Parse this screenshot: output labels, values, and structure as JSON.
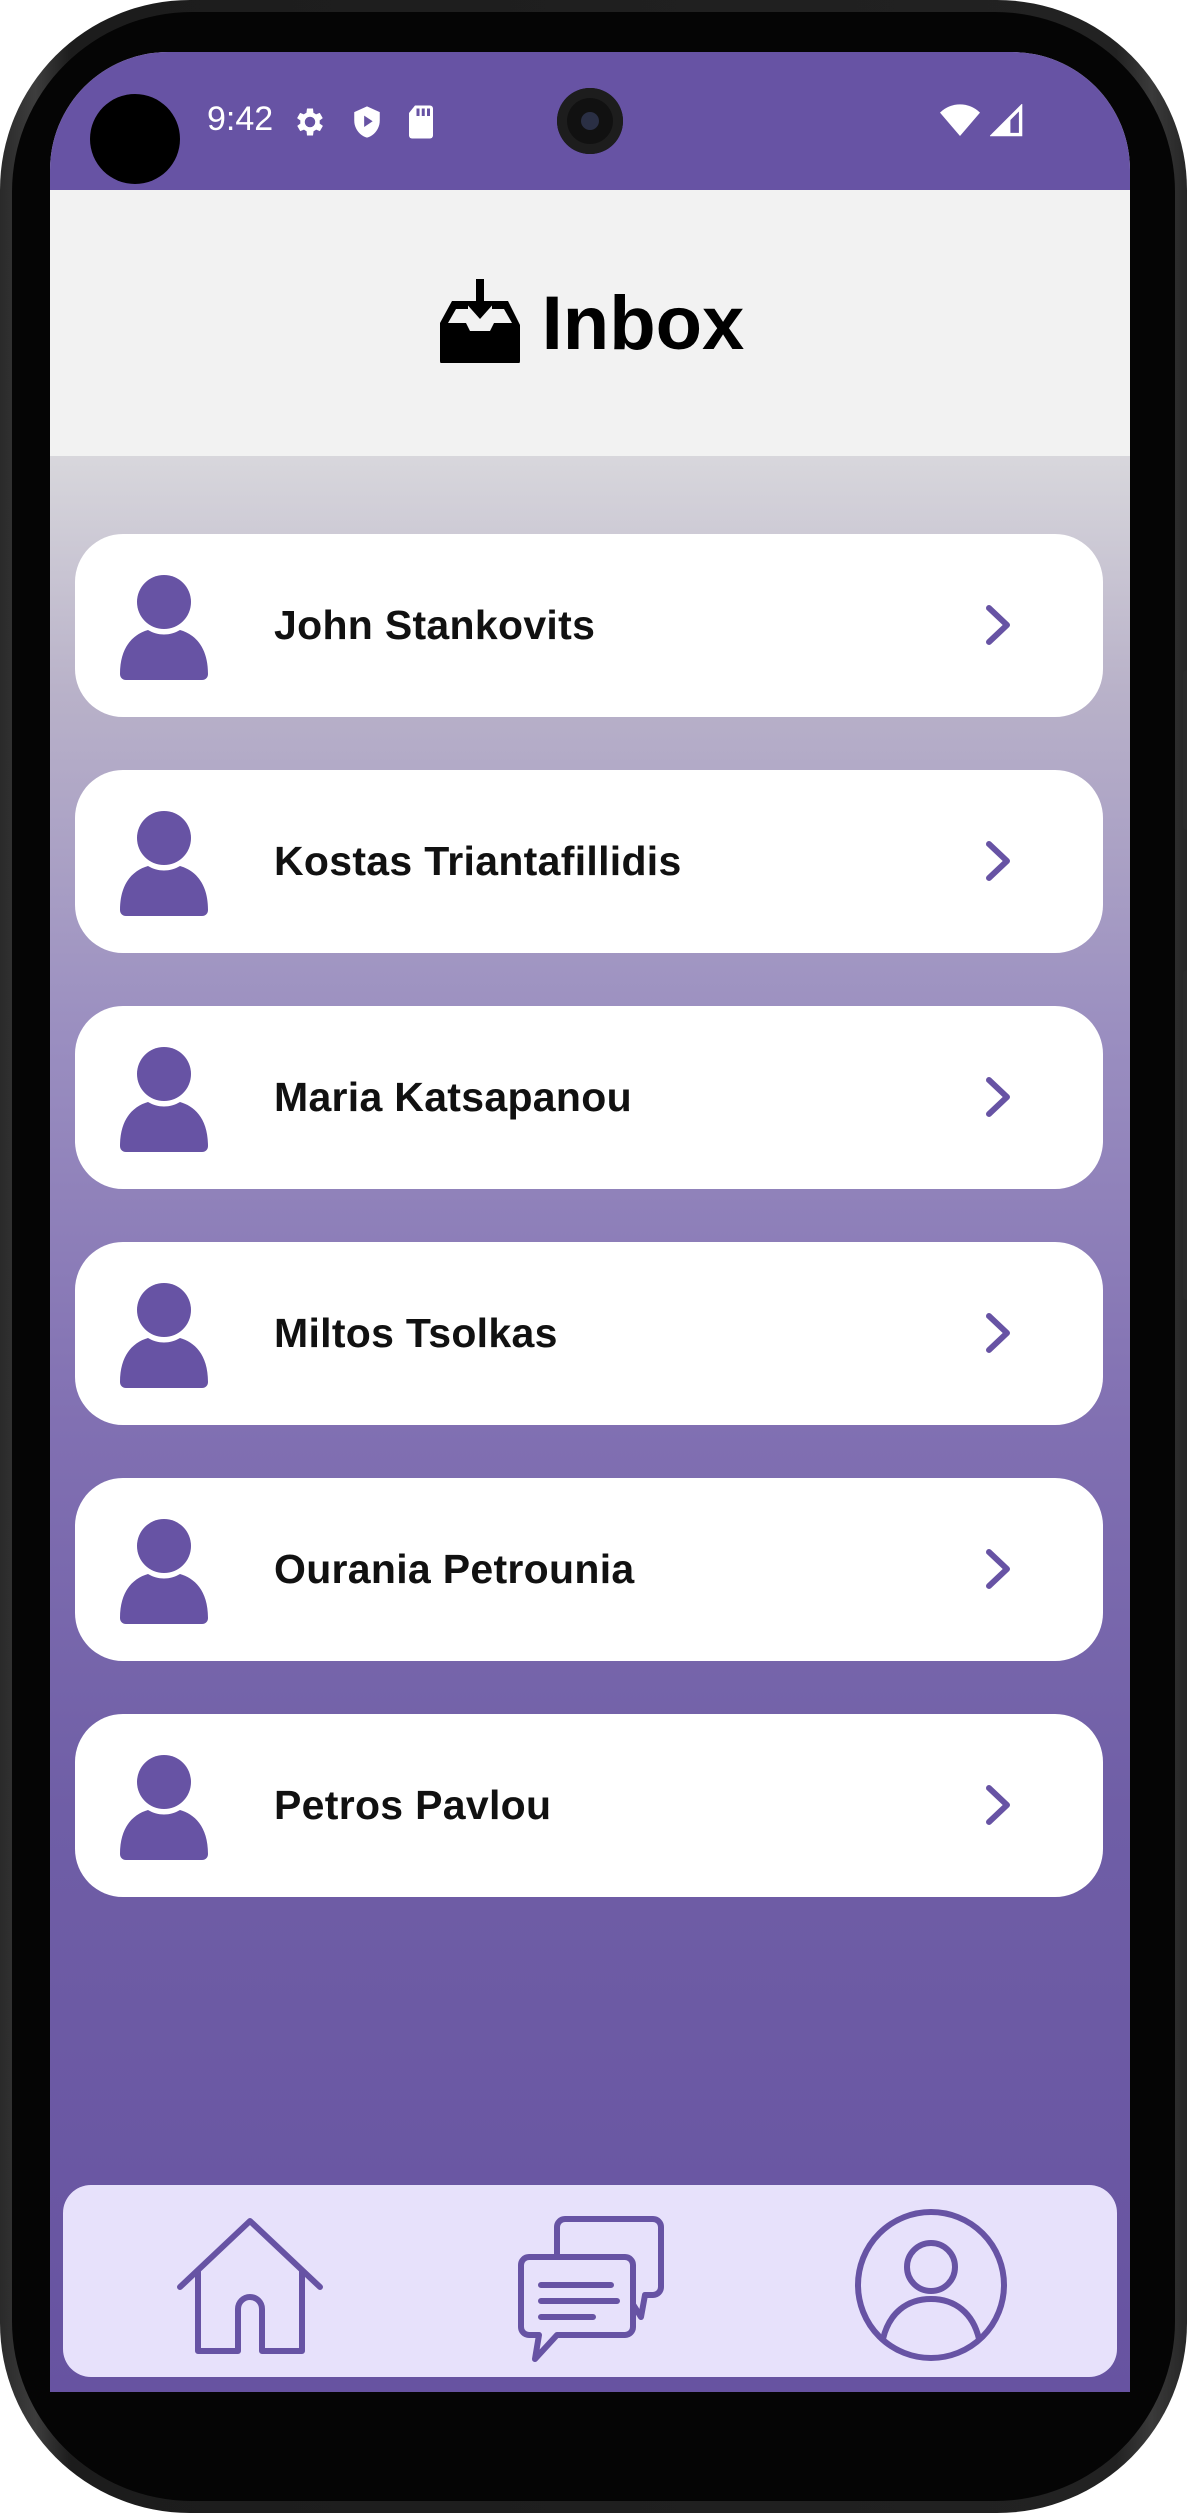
{
  "status_bar": {
    "time": "9:42",
    "icons_left": [
      "settings-icon",
      "shield-play-icon",
      "sd-card-icon"
    ],
    "icons_right": [
      "wifi-icon",
      "signal-icon"
    ]
  },
  "header": {
    "icon": "inbox-download-icon",
    "title": "Inbox"
  },
  "contacts": [
    {
      "name": "John Stankovits"
    },
    {
      "name": "Kostas Triantafillidis"
    },
    {
      "name": "Maria Katsapanou"
    },
    {
      "name": "Miltos Tsolkas"
    },
    {
      "name": "Ourania Petrounia"
    },
    {
      "name": "Petros Pavlou"
    }
  ],
  "bottom_nav": {
    "items": [
      "home-icon",
      "chat-icon",
      "profile-icon"
    ]
  },
  "colors": {
    "accent": "#6753a4",
    "nav_background": "#e7e1fb",
    "header_background": "#f2f2f2",
    "card_background": "#ffffff"
  }
}
